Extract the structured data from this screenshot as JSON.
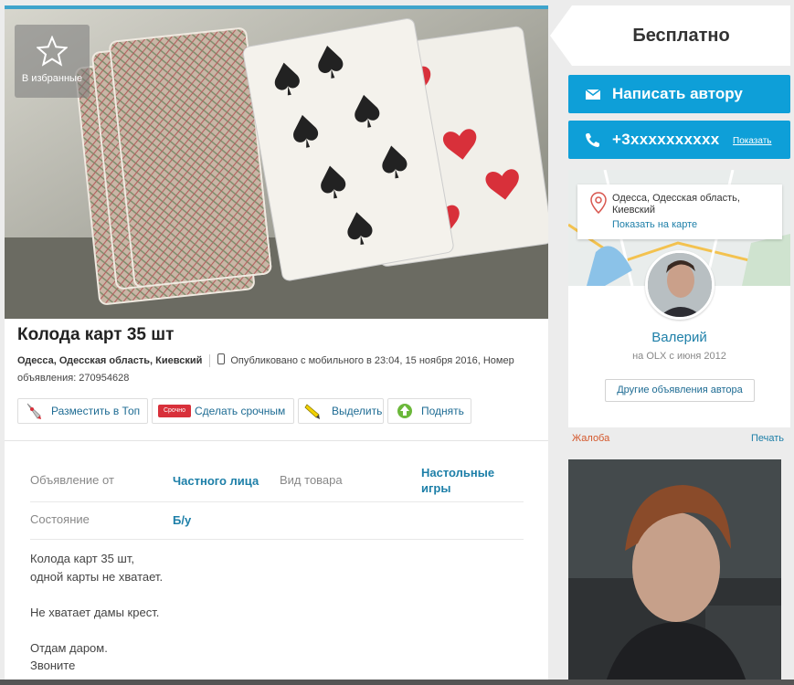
{
  "favorite": {
    "label": "В избранные",
    "icon": "star-icon"
  },
  "listing": {
    "title": "Колода карт 35 шт",
    "location": "Одесса, Одесская область, Киевский",
    "published": "Опубликовано с мобильного   в 23:04, 15 ноября 2016, Номер объявления: 270954628"
  },
  "promotions": [
    {
      "label": "Разместить в Топ",
      "icon": "rocket-icon"
    },
    {
      "label": "Сделать срочным",
      "icon": "urgent-tag-icon",
      "badge": "Срочно"
    },
    {
      "label": "Выделить",
      "icon": "highlighter-icon"
    },
    {
      "label": "Поднять",
      "icon": "raise-up-icon"
    }
  ],
  "params": [
    {
      "label": "Объявление от",
      "value": "Частного лица"
    },
    {
      "label": "Вид товара",
      "value": "Настольные игры"
    },
    {
      "label": "Состояние",
      "value": "Б/у"
    }
  ],
  "description": "Колода карт 35 шт,\nодной карты не хватает.\n\nНе хватает дамы крест.\n\nОтдам даром.\nЗвоните",
  "sidebar": {
    "price": "Бесплатно",
    "write_label": "Написать автору",
    "phone_label": "+3xxxxxxxxxx",
    "show_label": "Показать",
    "address": "Одесса, Одесская область, Киевский",
    "map_link": "Показать на карте",
    "author_name": "Валерий",
    "since": "на OLX с июня 2012",
    "other_ads": "Другие объявления автора",
    "complain": "Жалоба",
    "print": "Печать"
  },
  "colors": {
    "accent": "#0e9fd8",
    "link": "#1d7fa8",
    "complain": "#d4572b"
  }
}
